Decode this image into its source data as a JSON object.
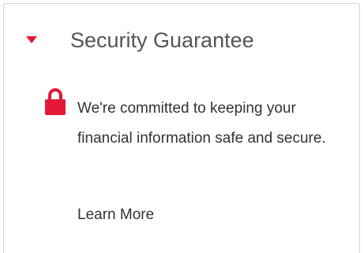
{
  "panel": {
    "title": "Security Guarantee",
    "description": "We're committed to keeping your financial information safe and secure.",
    "link_label": "Learn More",
    "expand_icon": "caret-down-icon",
    "lock_icon": "lock-icon",
    "expanded": true
  },
  "colors": {
    "accent": "#e31837",
    "title_text": "#555555",
    "body_text": "#333333",
    "border": "#d4d4d4"
  }
}
